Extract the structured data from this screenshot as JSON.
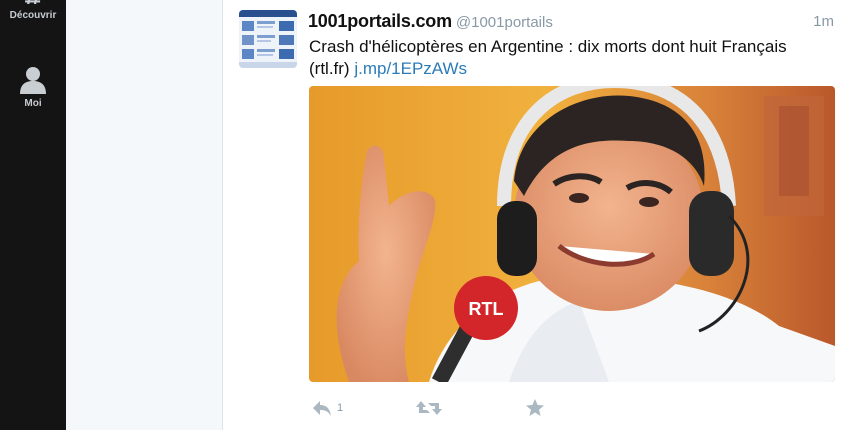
{
  "sidebar": {
    "items": [
      {
        "label": "Découvrir",
        "icon": "hashtag-icon"
      },
      {
        "label": "Moi",
        "icon": "user-icon"
      }
    ]
  },
  "tweet": {
    "display_name": "1001portails.com",
    "handle": "@1001portails",
    "time": "1m",
    "text_main": "Crash d'hélicoptères en Argentine : dix morts dont huit Français",
    "text_source": "(rtl.fr)",
    "link": "j.mp/1EPzAWs",
    "media_mic_label": "RTL",
    "actions": {
      "reply_count": "1",
      "icons": [
        "reply-icon",
        "retweet-icon",
        "favorite-star-icon"
      ]
    }
  },
  "colors": {
    "sidebar_bg": "#141414",
    "link": "#2b7bb9",
    "muted": "#8899a6",
    "mic_red": "#d3262b"
  }
}
